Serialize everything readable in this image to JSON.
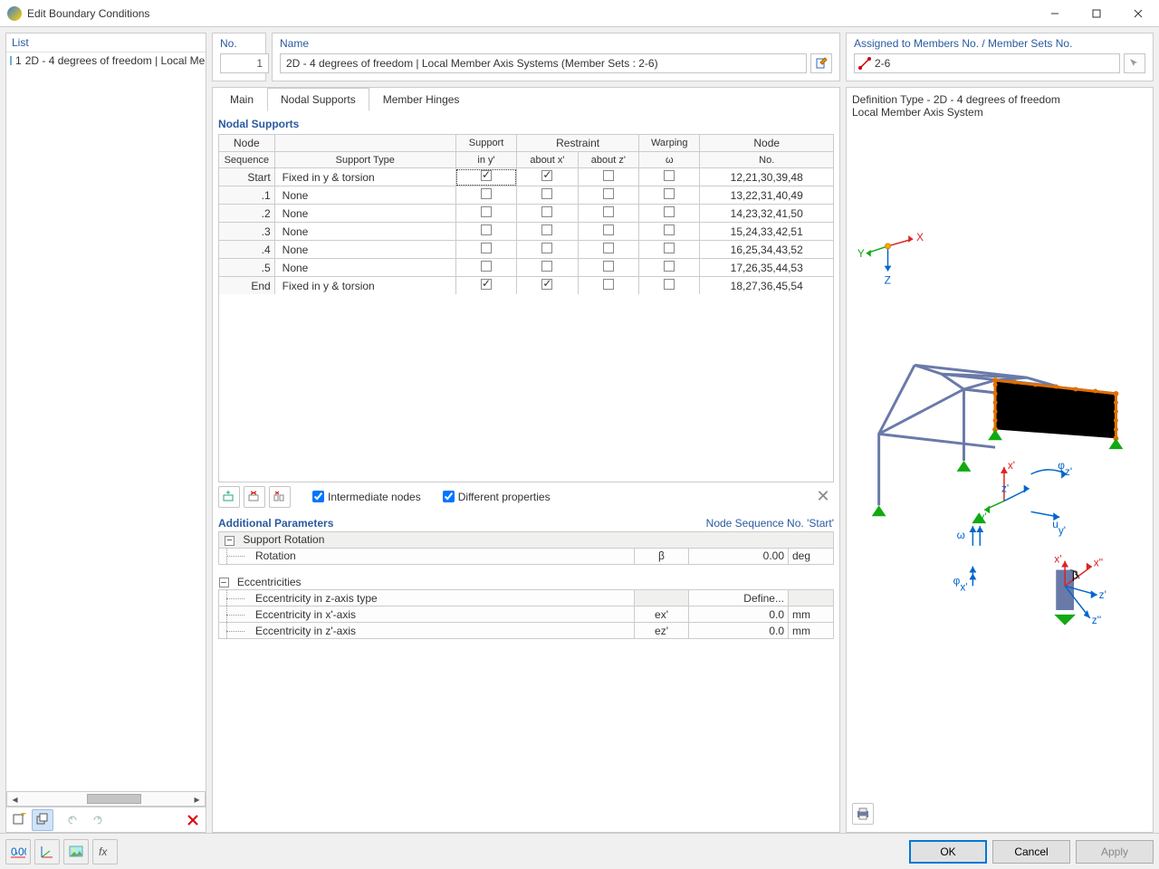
{
  "window": {
    "title": "Edit Boundary Conditions"
  },
  "sidebar": {
    "header": "List",
    "items": [
      {
        "num": "1",
        "label": "2D - 4 degrees of freedom | Local Me"
      }
    ]
  },
  "no_field": {
    "label": "No.",
    "value": "1"
  },
  "name_field": {
    "label": "Name",
    "value": "2D - 4 degrees of freedom | Local Member Axis Systems (Member Sets : 2-6)"
  },
  "assigned": {
    "label": "Assigned to Members No. / Member Sets No.",
    "value": "2-6"
  },
  "tabs": {
    "main": "Main",
    "nodal": "Nodal Supports",
    "hinges": "Member Hinges"
  },
  "section_title": "Nodal Supports",
  "table_headers": {
    "node_seq1": "Node",
    "node_seq2": "Sequence",
    "support_type": "Support Type",
    "support_in": "Support",
    "support_in2": "in y'",
    "restraint": "Restraint",
    "about_x": "about x'",
    "about_z": "about z'",
    "warping": "Warping",
    "omega": "ω",
    "node_no": "Node",
    "node_no2": "No."
  },
  "rows": [
    {
      "seq": "Start",
      "type": "Fixed in y & torsion",
      "iny": true,
      "ax": true,
      "az": false,
      "w": false,
      "nodes": "12,21,30,39,48",
      "hl": true
    },
    {
      "seq": ".1",
      "type": "None",
      "iny": false,
      "ax": false,
      "az": false,
      "w": false,
      "nodes": "13,22,31,40,49"
    },
    {
      "seq": ".2",
      "type": "None",
      "iny": false,
      "ax": false,
      "az": false,
      "w": false,
      "nodes": "14,23,32,41,50"
    },
    {
      "seq": ".3",
      "type": "None",
      "iny": false,
      "ax": false,
      "az": false,
      "w": false,
      "nodes": "15,24,33,42,51"
    },
    {
      "seq": ".4",
      "type": "None",
      "iny": false,
      "ax": false,
      "az": false,
      "w": false,
      "nodes": "16,25,34,43,52"
    },
    {
      "seq": ".5",
      "type": "None",
      "iny": false,
      "ax": false,
      "az": false,
      "w": false,
      "nodes": "17,26,35,44,53"
    },
    {
      "seq": "End",
      "type": "Fixed in y & torsion",
      "iny": true,
      "ax": true,
      "az": false,
      "w": false,
      "nodes": "18,27,36,45,54"
    }
  ],
  "row_options": {
    "intermediate": "Intermediate nodes",
    "different": "Different properties"
  },
  "addl_title": "Additional Parameters",
  "addl_subtitle": "Node Sequence No. 'Start'",
  "groups": {
    "support_rotation": "Support Rotation",
    "rotation": {
      "label": "Rotation",
      "sym": "β",
      "val": "0.00",
      "unit": "deg"
    },
    "eccentricities": "Eccentricities",
    "ecc_type": {
      "label": "Eccentricity in z-axis type",
      "val": "Define..."
    },
    "ecc_x": {
      "label": "Eccentricity in x'-axis",
      "sym": "ex'",
      "val": "0.0",
      "unit": "mm"
    },
    "ecc_z": {
      "label": "Eccentricity in z'-axis",
      "sym": "ez'",
      "val": "0.0",
      "unit": "mm"
    }
  },
  "right": {
    "line1": "Definition Type - 2D - 4 degrees of freedom",
    "line2": "Local Member Axis System"
  },
  "buttons": {
    "ok": "OK",
    "cancel": "Cancel",
    "apply": "Apply"
  }
}
